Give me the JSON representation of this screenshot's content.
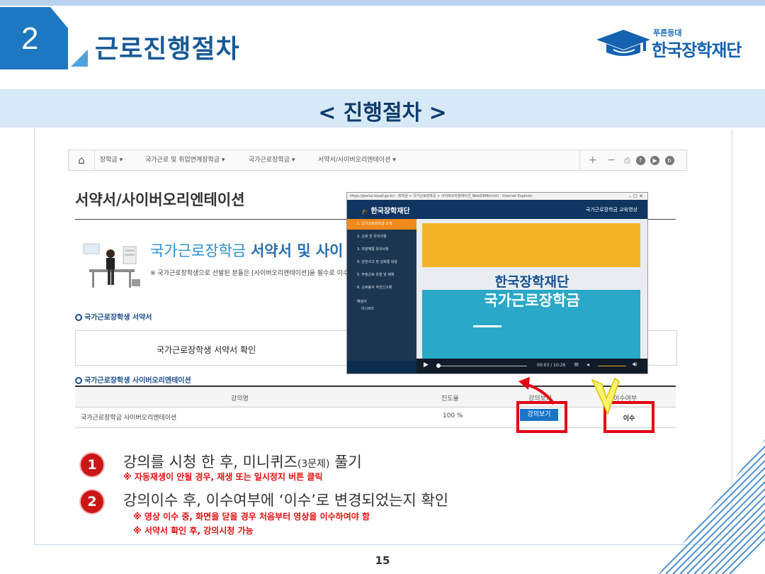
{
  "header": {
    "section_number": "2",
    "title": "근로진행절차",
    "logo_tagline": "푸른등대",
    "logo_name": "한국장학재단"
  },
  "band_title": "< 진행절차 >",
  "web": {
    "nav": {
      "items": [
        "장학금 ▾",
        "국가근로 및 취업연계장학금 ▾",
        "국가근로장학금 ▾",
        "서약서/사이버오리엔테이션 ▾"
      ],
      "tools": [
        "+",
        "−",
        "⎙",
        "f",
        "▶",
        "b"
      ]
    },
    "page_title": "서약서/사이버오리엔테이션",
    "headline_prefix": "국가근로장학금",
    "headline_bold": "서약서 및 사이",
    "notice": "※ 국가근로장학생으로 선발된 분들은 [사이버오리엔테이션]을 필수로 이수",
    "section_oath": "국가근로장학생 서약서",
    "oath_confirm": "국가근로장학생 서약서 확인",
    "section_cyber": "국가근로장학생 사이버오리엔테이션",
    "table_headers": [
      "강의명",
      "진도율",
      "강의보기",
      "이수여부"
    ],
    "row": {
      "name": "국가근로장학금 사이버오리엔테이션",
      "progress": "100 %",
      "button": "강의보기",
      "status": "이수"
    }
  },
  "player": {
    "address": "https://portal.kosaf.go.kr/ - 장학금 > 국가근로장학금 > 사이버오리엔테이션_WebDRM(m16) - Internet Explorer",
    "logo": "한국장학재단",
    "logo_small": "푸른등대",
    "header_right": "국가근로장학금 교육영상",
    "menu": [
      "1. 국가근로장학금 소개",
      "2. 근로 전 유의사항",
      "3. 직장예절 유의사항",
      "4. 안전사고 및 성희롱 대응",
      "5. 부정근로 유형 및 제재",
      "6. 근로봉사 자진신고제"
    ],
    "menu_quiz": "해설지",
    "menu_quiz_sub": "미니퀴즈",
    "screen_line1": "한국장학재단",
    "screen_line2": "국가근로장학금",
    "time": "00:03 / 10:26"
  },
  "steps": [
    {
      "number": "1",
      "text_a": "강의를 시청 한 후, 미니퀴즈",
      "text_small": "(3문제)",
      "text_b": " 풀기",
      "notes": [
        "※  자동재생이 안될 경우, 재생 또는 일시정지 버튼 클릭"
      ]
    },
    {
      "number": "2",
      "text_a": "강의이수 후, 이수여부에 ‘이수’로 변경되었는지 확인",
      "notes": [
        "※ 영상 이수 중, 화면을 닫을 경우 처음부터 영상을 이수하여야 함",
        "※ 서약서 확인 후, 강의시청 가능"
      ]
    }
  ],
  "page_number": "15",
  "colors": {
    "brand_blue": "#1d78c1",
    "title_blue": "#1a5a98",
    "band": "#d7e8f7",
    "alert_red": "#e50012",
    "video_orange": "#f08a1c"
  }
}
